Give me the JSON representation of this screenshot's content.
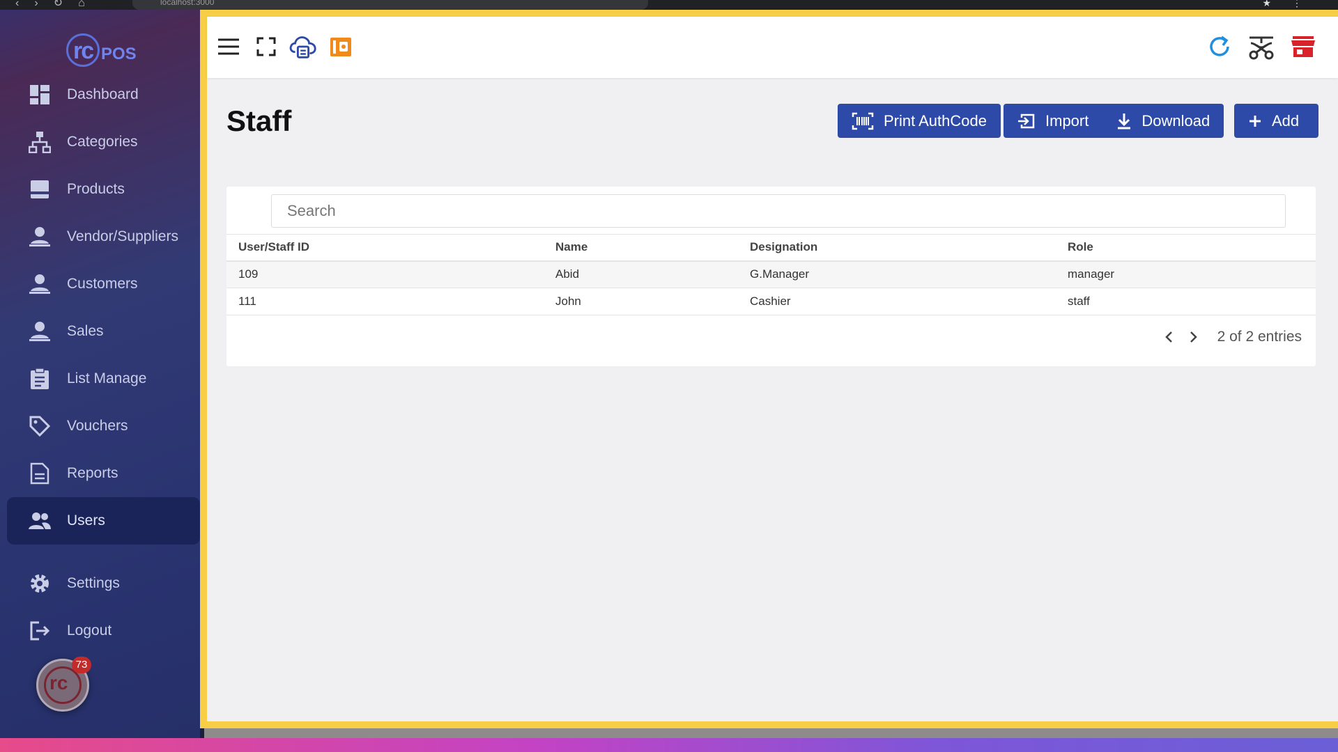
{
  "browser": {
    "url": "localhost:3000"
  },
  "brand": {
    "logo_rc": "rc",
    "logo_pos": "POS"
  },
  "sidebar": {
    "items": [
      {
        "label": "Dashboard",
        "icon": "dashboard-icon"
      },
      {
        "label": "Categories",
        "icon": "categories-icon"
      },
      {
        "label": "Products",
        "icon": "products-icon"
      },
      {
        "label": "Vendor/Suppliers",
        "icon": "vendor-icon"
      },
      {
        "label": "Customers",
        "icon": "customers-icon"
      },
      {
        "label": "Sales",
        "icon": "sales-icon"
      },
      {
        "label": "List Manage",
        "icon": "clipboard-icon"
      },
      {
        "label": "Vouchers",
        "icon": "tag-icon"
      },
      {
        "label": "Reports",
        "icon": "report-icon"
      },
      {
        "label": "Users",
        "icon": "users-icon"
      }
    ],
    "settings_label": "Settings",
    "logout_label": "Logout",
    "active": "Users"
  },
  "floating_badge": {
    "text": "rc",
    "count": "73"
  },
  "page": {
    "title": "Staff"
  },
  "actions": {
    "print_auth_label": "Print AuthCode",
    "import_label": "Import",
    "download_label": "Download",
    "add_label": "Add"
  },
  "search": {
    "placeholder": "Search"
  },
  "table": {
    "headers": [
      "User/Staff ID",
      "Name",
      "Designation",
      "Role"
    ],
    "rows": [
      [
        "109",
        "Abid",
        "G.Manager",
        "manager"
      ],
      [
        "111",
        "John",
        "Cashier",
        "staff"
      ]
    ]
  },
  "pagination": {
    "text": "2 of 2 entries"
  },
  "colors": {
    "accent": "#2d4aa8",
    "frame": "#f7ce45",
    "sidebar_active": "#1b2458"
  }
}
